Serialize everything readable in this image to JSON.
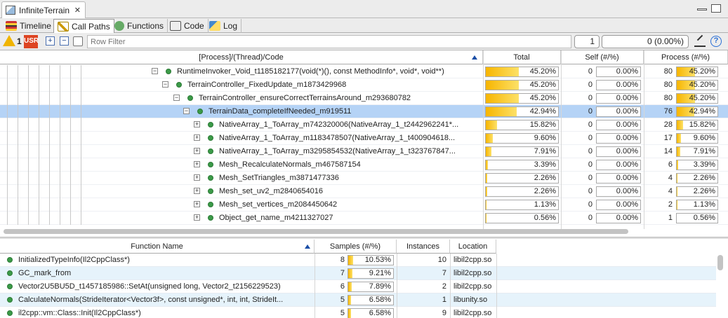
{
  "window": {
    "title": "InfiniteTerrain",
    "close_glyph": "✕"
  },
  "tabs": [
    {
      "label": "Timeline",
      "icon": "timeline-icon",
      "active": false
    },
    {
      "label": "Call Paths",
      "icon": "callpaths-icon",
      "active": true
    },
    {
      "label": "Functions",
      "icon": "functions-icon",
      "active": false
    },
    {
      "label": "Code",
      "icon": "code-icon",
      "active": false
    },
    {
      "label": "Log",
      "icon": "log-icon",
      "active": false
    }
  ],
  "toolbar": {
    "warning_count": "1",
    "usr_badge": "USR",
    "expand_glyph": "+",
    "collapse_glyph": "−",
    "filter_placeholder": "Row Filter",
    "search_count": "1",
    "summary": "0 (0.00%)",
    "help_glyph": "?"
  },
  "upper_table": {
    "columns": {
      "code": "[Process]/(Thread)/Code",
      "total": "Total",
      "self": "Self (#/%)",
      "process": "Process (#/%)"
    },
    "rows": [
      {
        "name": "RuntimeInvoker_Void_t1185182177(void(*)(), const MethodInfo*, void*, void**)",
        "total": "45.20%",
        "total_frac": 0.452,
        "self_count": "0",
        "self_pct": "0.00%",
        "proc_count": "80",
        "proc_pct": "45.20%",
        "expander": "−"
      },
      {
        "name": "TerrainController_FixedUpdate_m1873429968",
        "total": "45.20%",
        "total_frac": 0.452,
        "self_count": "0",
        "self_pct": "0.00%",
        "proc_count": "80",
        "proc_pct": "45.20%",
        "expander": "−"
      },
      {
        "name": "TerrainController_ensureCorrectTerrainsAround_m293680782",
        "total": "45.20%",
        "total_frac": 0.452,
        "self_count": "0",
        "self_pct": "0.00%",
        "proc_count": "80",
        "proc_pct": "45.20%",
        "expander": "−"
      },
      {
        "name": "TerrainData_completeIfNeeded_m919511",
        "total": "42.94%",
        "total_frac": 0.4294,
        "self_count": "0",
        "self_pct": "0.00%",
        "proc_count": "76",
        "proc_pct": "42.94%",
        "expander": "−"
      },
      {
        "name": "NativeArray_1_ToArray_m742320006(NativeArray_1_t2442962241*...",
        "total": "15.82%",
        "total_frac": 0.1582,
        "self_count": "0",
        "self_pct": "0.00%",
        "proc_count": "28",
        "proc_pct": "15.82%",
        "expander": "+"
      },
      {
        "name": "NativeArray_1_ToArray_m1183478507(NativeArray_1_t400904618...",
        "total": "9.60%",
        "total_frac": 0.096,
        "self_count": "0",
        "self_pct": "0.00%",
        "proc_count": "17",
        "proc_pct": "9.60%",
        "expander": "+"
      },
      {
        "name": "NativeArray_1_ToArray_m3295854532(NativeArray_1_t323767847...",
        "total": "7.91%",
        "total_frac": 0.0791,
        "self_count": "0",
        "self_pct": "0.00%",
        "proc_count": "14",
        "proc_pct": "7.91%",
        "expander": "+"
      },
      {
        "name": "Mesh_RecalculateNormals_m467587154",
        "total": "3.39%",
        "total_frac": 0.0339,
        "self_count": "0",
        "self_pct": "0.00%",
        "proc_count": "6",
        "proc_pct": "3.39%",
        "expander": "+"
      },
      {
        "name": "Mesh_SetTriangles_m3871477336",
        "total": "2.26%",
        "total_frac": 0.0226,
        "self_count": "0",
        "self_pct": "0.00%",
        "proc_count": "4",
        "proc_pct": "2.26%",
        "expander": "+"
      },
      {
        "name": "Mesh_set_uv2_m2840654016",
        "total": "2.26%",
        "total_frac": 0.0226,
        "self_count": "0",
        "self_pct": "0.00%",
        "proc_count": "4",
        "proc_pct": "2.26%",
        "expander": "+"
      },
      {
        "name": "Mesh_set_vertices_m2084450642",
        "total": "1.13%",
        "total_frac": 0.0113,
        "self_count": "0",
        "self_pct": "0.00%",
        "proc_count": "2",
        "proc_pct": "1.13%",
        "expander": "+"
      },
      {
        "name": "Object_get_name_m4211327027",
        "total": "0.56%",
        "total_frac": 0.0056,
        "self_count": "0",
        "self_pct": "0.00%",
        "proc_count": "1",
        "proc_pct": "0.56%",
        "expander": "+"
      }
    ]
  },
  "lower_table": {
    "columns": {
      "function": "Function Name",
      "samples": "Samples (#/%)",
      "instances": "Instances",
      "location": "Location"
    },
    "rows": [
      {
        "name": "InitializedTypeInfo(Il2CppClass*)",
        "count": "8",
        "pct": "10.53%",
        "frac": 0.1053,
        "instances": "10",
        "location": "libil2cpp.so"
      },
      {
        "name": "GC_mark_from",
        "count": "7",
        "pct": "9.21%",
        "frac": 0.0921,
        "instances": "7",
        "location": "libil2cpp.so"
      },
      {
        "name": "Vector2U5BU5D_t1457185986::SetAt(unsigned long, Vector2_t2156229523)",
        "count": "6",
        "pct": "7.89%",
        "frac": 0.0789,
        "instances": "2",
        "location": "libil2cpp.so"
      },
      {
        "name": "CalculateNormals(StrideIterator<Vector3f>, const unsigned*, int, int, StrideIt...",
        "count": "5",
        "pct": "6.58%",
        "frac": 0.0658,
        "instances": "1",
        "location": "libunity.so"
      },
      {
        "name": "il2cpp::vm::Class::Init(Il2CppClass*)",
        "count": "5",
        "pct": "6.58%",
        "frac": 0.0658,
        "instances": "9",
        "location": "libil2cpp.so"
      }
    ]
  }
}
